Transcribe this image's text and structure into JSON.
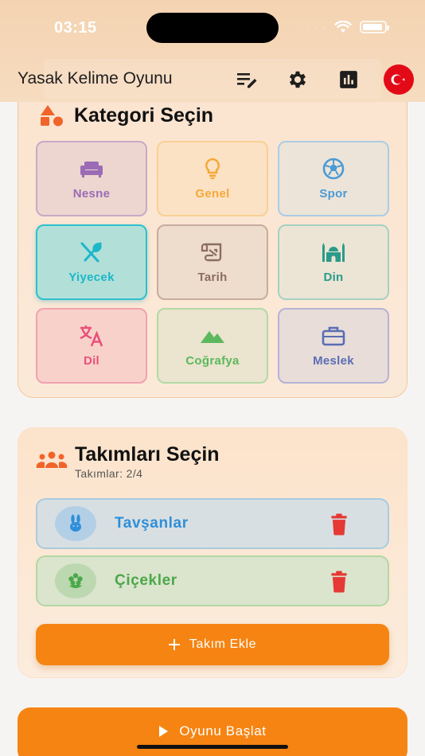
{
  "status_bar": {
    "time": "03:15",
    "signal_dots": "· · · ·"
  },
  "header": {
    "title": "Yasak Kelime Oyunu"
  },
  "categories": {
    "title": "Kategori Seçin",
    "items": [
      {
        "label": "Nesne",
        "icon": "sofa-icon",
        "color": "#9b6bb5",
        "bg": "#ecd6cf",
        "border": "#c9a9c9"
      },
      {
        "label": "Genel",
        "icon": "lightbulb-icon",
        "color": "#f5a83a",
        "bg": "#fbe2c4",
        "border": "#f8cf93"
      },
      {
        "label": "Spor",
        "icon": "soccer-ball-icon",
        "color": "#4a9ad6",
        "bg": "#ece4d8",
        "border": "#a9cde6"
      },
      {
        "label": "Yiyecek",
        "icon": "utensils-icon",
        "color": "#1db7c8",
        "bg": "#b2e0d9",
        "border": "#2fc0ce"
      },
      {
        "label": "Tarih",
        "icon": "scroll-icon",
        "color": "#8b6d60",
        "bg": "#eedccc",
        "border": "#c7ad9e"
      },
      {
        "label": "Din",
        "icon": "mosque-icon",
        "color": "#2c9a8a",
        "bg": "#ece5d6",
        "border": "#a6d1c3"
      },
      {
        "label": "Dil",
        "icon": "translate-icon",
        "color": "#e9507a",
        "bg": "#f8d2ca",
        "border": "#f1a2b0"
      },
      {
        "label": "Coğrafya",
        "icon": "mountain-icon",
        "color": "#5cb85c",
        "bg": "#ebe4cf",
        "border": "#b3d9a7"
      },
      {
        "label": "Meslek",
        "icon": "briefcase-icon",
        "color": "#5a6db5",
        "bg": "#e8ddd8",
        "border": "#b6b2d6"
      }
    ]
  },
  "teams": {
    "title": "Takımları Seçin",
    "subtitle": "Takımlar: 2/4",
    "list": [
      {
        "name": "Tavşanlar",
        "icon": "rabbit-icon",
        "color": "#2f8fd8",
        "bg": "#d8dfe2",
        "border": "#a9cbe0",
        "avatar_bg": "#b3cfe6"
      },
      {
        "name": "Çiçekler",
        "icon": "flower-icon",
        "color": "#4aa84a",
        "bg": "#dbe4cd",
        "border": "#b3d7a2",
        "avatar_bg": "#bcd8b0"
      }
    ],
    "add_label": "Takım Ekle"
  },
  "start_label": "Oyunu Başlat",
  "colors": {
    "accent": "#f68412",
    "trash": "#e53935",
    "title_icon": "#f0642a"
  }
}
